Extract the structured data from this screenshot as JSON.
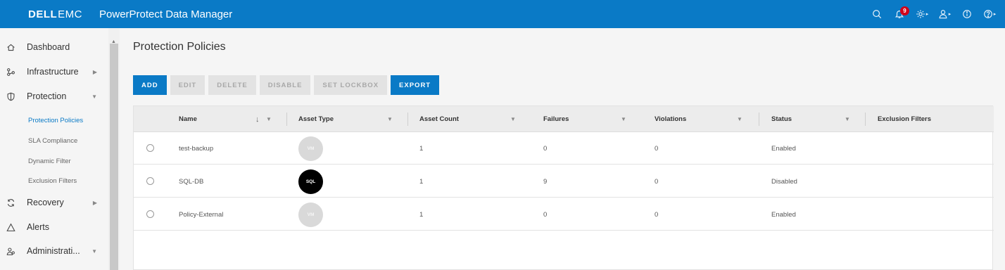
{
  "header": {
    "brand_dell": "DELL",
    "brand_emc": "EMC",
    "product": "PowerProtect Data Manager",
    "notification_count": "9",
    "icons": [
      "search-icon",
      "bell-icon",
      "gear-icon",
      "user-icon",
      "info-icon",
      "help-icon"
    ]
  },
  "sidebar": {
    "items": [
      {
        "label": "Dashboard",
        "icon": "home-icon"
      },
      {
        "label": "Infrastructure",
        "icon": "infrastructure-icon"
      },
      {
        "label": "Protection",
        "icon": "shield-icon"
      },
      {
        "label": "Recovery",
        "icon": "recovery-icon"
      },
      {
        "label": "Alerts",
        "icon": "alert-icon"
      },
      {
        "label": "Administrati...",
        "icon": "admin-icon"
      }
    ],
    "protection_sub": [
      {
        "label": "Protection Policies",
        "active": true
      },
      {
        "label": "SLA Compliance"
      },
      {
        "label": "Dynamic Filter"
      },
      {
        "label": "Exclusion Filters"
      }
    ]
  },
  "main": {
    "title": "Protection Policies",
    "toolbar": {
      "add": "ADD",
      "edit": "EDIT",
      "delete": "DELETE",
      "disable": "DISABLE",
      "set_lockbox": "SET LOCKBOX",
      "export": "EXPORT"
    },
    "table": {
      "columns": [
        "Name",
        "Asset Type",
        "Asset Count",
        "Failures",
        "Violations",
        "Status",
        "Exclusion Filters"
      ],
      "rows": [
        {
          "name": "test-backup",
          "asset_type": "VM",
          "asset_count": "1",
          "failures": "0",
          "violations": "0",
          "status": "Enabled"
        },
        {
          "name": "SQL-DB",
          "asset_type": "SQL",
          "asset_count": "1",
          "failures": "9",
          "violations": "0",
          "status": "Disabled"
        },
        {
          "name": "Policy-External",
          "asset_type": "VM",
          "asset_count": "1",
          "failures": "0",
          "violations": "0",
          "status": "Enabled"
        }
      ]
    }
  },
  "colors": {
    "accent": "#0a7ac6",
    "badge_red": "#d0021b",
    "vm_badge": "#d9d9d9",
    "sql_badge": "#000000"
  }
}
